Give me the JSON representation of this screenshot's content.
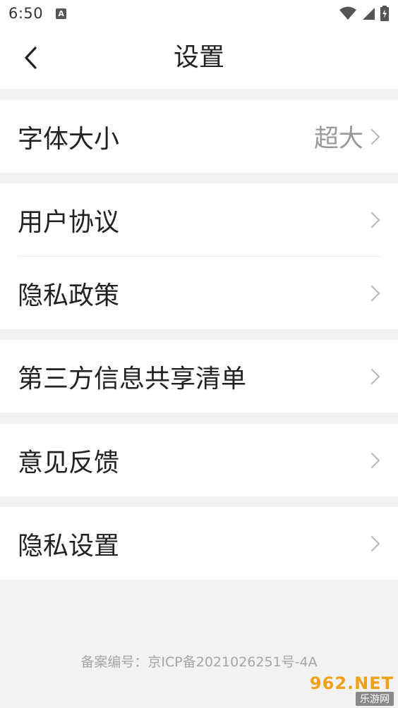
{
  "status_bar": {
    "time": "6:50",
    "notification_icon_letter": "A",
    "icons": [
      "wifi-icon",
      "signal-icon",
      "battery-charging-icon"
    ]
  },
  "header": {
    "title": "设置",
    "back_icon": "back-arrow-icon"
  },
  "settings": {
    "font_size": {
      "label": "字体大小",
      "value": "超大"
    },
    "user_agreement": {
      "label": "用户协议"
    },
    "privacy_policy": {
      "label": "隐私政策"
    },
    "third_party_sharing": {
      "label": "第三方信息共享清单"
    },
    "feedback": {
      "label": "意见反馈"
    },
    "privacy_settings": {
      "label": "隐私设置"
    }
  },
  "footer": {
    "icp": "备案编号：京ICP备2021026251号-4A"
  },
  "watermark": {
    "top": "962.NET",
    "bottom": "乐游网"
  },
  "colors": {
    "background": "#f2f2f2",
    "surface": "#ffffff",
    "text": "#222222",
    "secondary_text": "#999999",
    "footer_text": "#a6a6a6"
  }
}
